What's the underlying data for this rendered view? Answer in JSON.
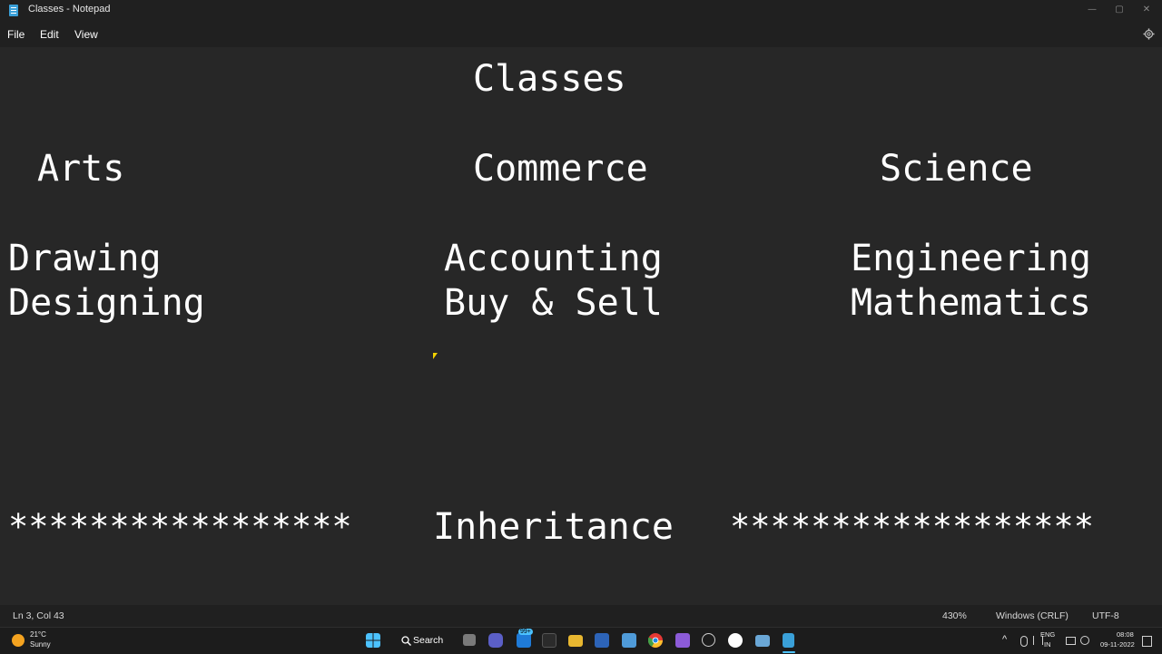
{
  "window": {
    "title": "Classes - Notepad",
    "controls": {
      "minimize": "—",
      "maximize": "▢",
      "close": "✕"
    }
  },
  "menu": {
    "file": "File",
    "edit": "Edit",
    "view": "View"
  },
  "editor": {
    "lines": {
      "title": "Classes",
      "arts": "Arts",
      "commerce": "Commerce",
      "science": "Science",
      "drawing": "Drawing",
      "accounting": "Accounting",
      "engineering": "Engineering",
      "designing": "Designing",
      "buysell": "Buy & Sell",
      "mathematics": "Mathematics",
      "stars_left": "*****************",
      "inheritance": "Inheritance",
      "stars_right": "******************"
    }
  },
  "status": {
    "position": "Ln 3, Col 43",
    "zoom": "430%",
    "line_ending": "Windows (CRLF)",
    "encoding": "UTF-8"
  },
  "taskbar": {
    "weather_temp": "21°C",
    "weather_cond": "Sunny",
    "search_label": "Search",
    "badge": "99+",
    "lang_top": "ENG",
    "lang_bottom": "IN",
    "time": "08:08",
    "date": "09-11-2022"
  },
  "colors": {
    "editor_bg": "#272727",
    "chrome_bg": "#202020",
    "taskbar_bg": "#1c1c1c",
    "text": "#ffffff",
    "accent": "#3aa0d8"
  }
}
